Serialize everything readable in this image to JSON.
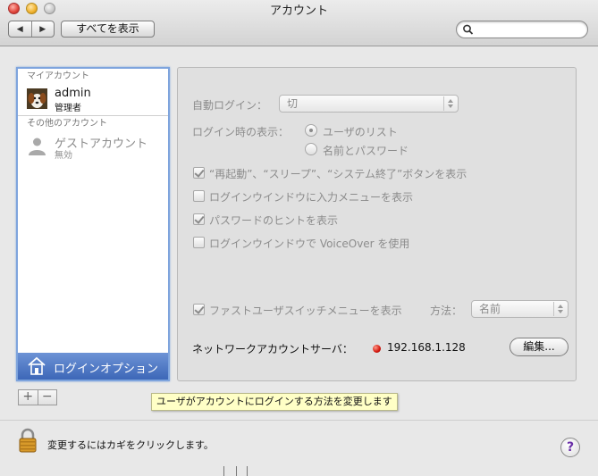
{
  "window": {
    "title": "アカウント"
  },
  "toolbar": {
    "back_label": "◀",
    "forward_label": "▶",
    "show_all_label": "すべてを表示",
    "search_placeholder": ""
  },
  "sidebar": {
    "my_account_heading": "マイアカウント",
    "admin": {
      "name": "admin",
      "role": "管理者"
    },
    "other_heading": "その他のアカウント",
    "guest": {
      "name": "ゲストアカウント",
      "status": "無効"
    },
    "login_options_label": "ログインオプション",
    "add_label": "+",
    "remove_label": "−"
  },
  "panel": {
    "auto_login_label": "自動ログイン：",
    "auto_login_value": "切",
    "display_label": "ログイン時の表示：",
    "display_options": [
      "ユーザのリスト",
      "名前とパスワード"
    ],
    "display_selected": 0,
    "checkboxes": [
      {
        "label": "“再起動”、“スリープ”、“システム終了”ボタンを表示",
        "checked": true
      },
      {
        "label": "ログインウインドウに入力メニューを表示",
        "checked": false
      },
      {
        "label": "パスワードのヒントを表示",
        "checked": true
      },
      {
        "label": "ログインウインドウで VoiceOver を使用",
        "checked": false
      }
    ],
    "fast_user_switch": {
      "label": "ファストユーザスイッチメニューを表示",
      "checked": true,
      "method_label": "方法：",
      "method_value": "名前"
    },
    "network_server_label": "ネットワークアカウントサーバ：",
    "network_server_value": "192.168.1.128",
    "network_status_color": "#d2140b",
    "edit_label": "編集..."
  },
  "tooltip": "ユーザがアカウントにログインする方法を変更します",
  "footer": {
    "lock_text": "変更するにはカギをクリックします。",
    "help_label": "?"
  },
  "colors": {
    "selection": "#3d67b8",
    "list_border": "#7ea4dd"
  }
}
